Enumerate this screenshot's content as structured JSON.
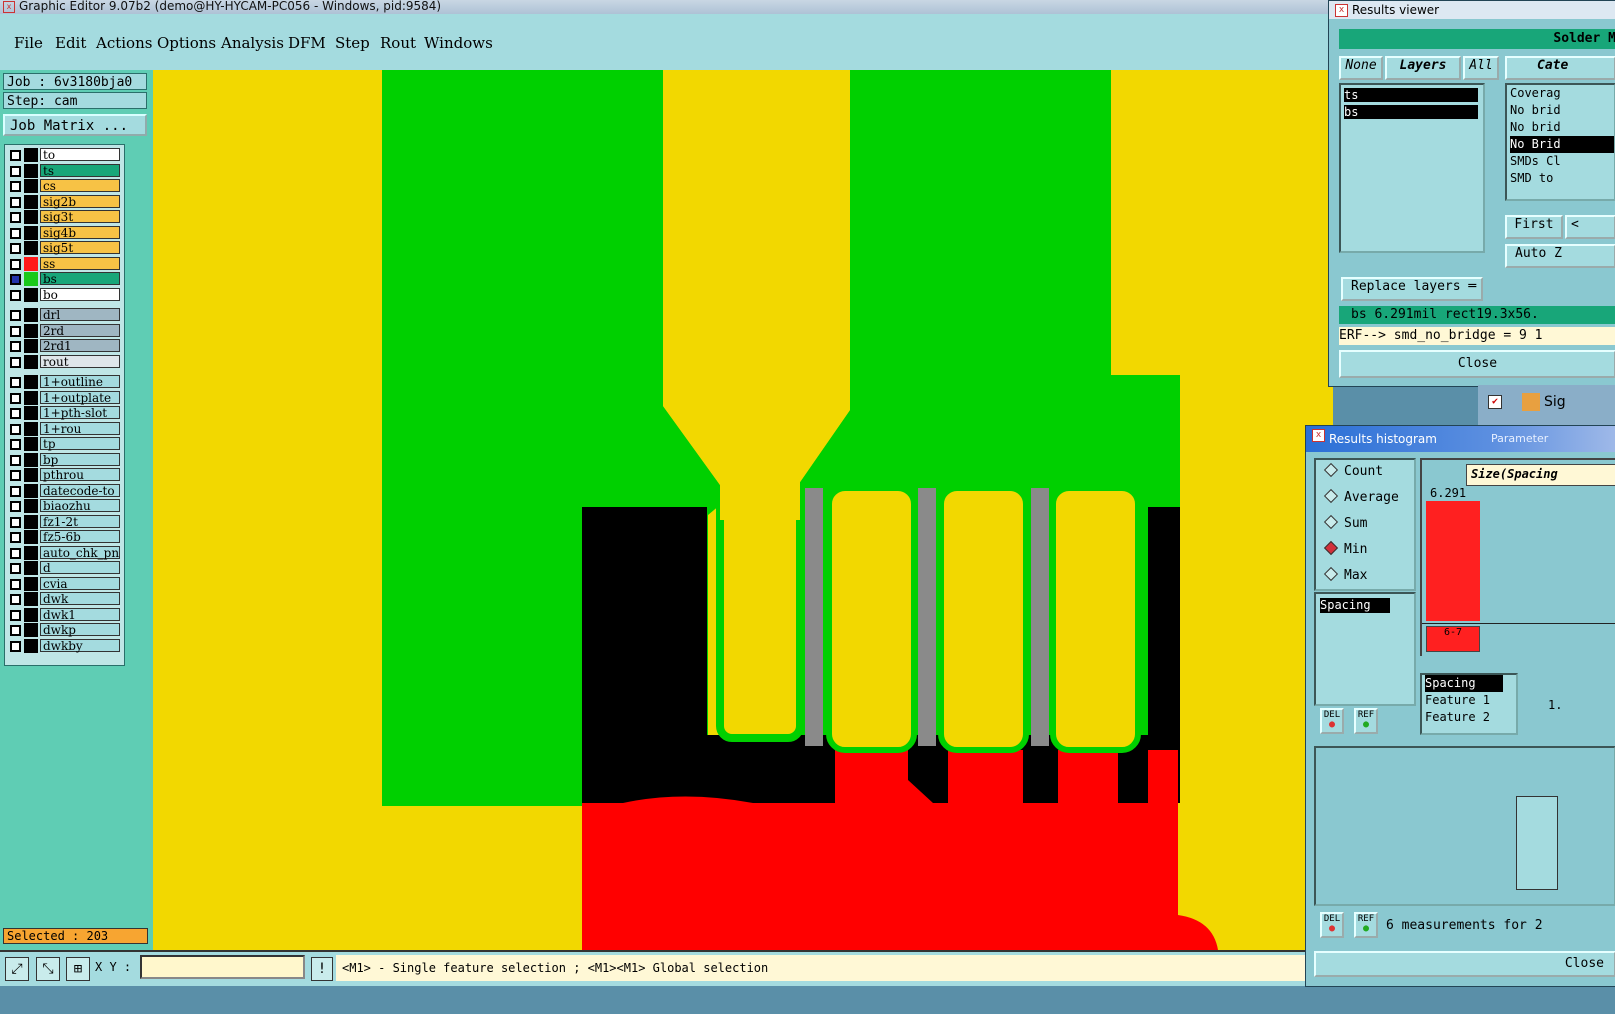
{
  "window_title": "Graphic Editor 9.07b2 (demo@HY-HYCAM-PC056 - Windows, pid:9584)",
  "menu": [
    "File",
    "Edit",
    "Actions",
    "Options",
    "Analysis",
    "DFM",
    "Step",
    "Rout",
    "Windows"
  ],
  "job": {
    "job_label": "Job : 6v3180bja0",
    "step_label": "Step: cam",
    "matrix_button": "Job Matrix ..."
  },
  "layers": [
    {
      "name": "to",
      "bg": "#ffffff",
      "sw": "#000000"
    },
    {
      "name": "ts",
      "bg": "#18a679",
      "sw": "#000000",
      "active": true
    },
    {
      "name": "cs",
      "bg": "#f7c245",
      "sw": "#000000"
    },
    {
      "name": "sig2b",
      "bg": "#f7c245",
      "sw": "#000000"
    },
    {
      "name": "sig3t",
      "bg": "#f7c245",
      "sw": "#000000"
    },
    {
      "name": "sig4b",
      "bg": "#f7c245",
      "sw": "#000000"
    },
    {
      "name": "sig5t",
      "bg": "#f7c245",
      "sw": "#000000"
    },
    {
      "name": "ss",
      "bg": "#f7c245",
      "sw": "#ff1a1a"
    },
    {
      "name": "bs",
      "bg": "#18a679",
      "sw": "#1ac91a",
      "work": true
    },
    {
      "name": "bo",
      "bg": "#ffffff",
      "sw": "#000000"
    },
    {
      "name": "drl",
      "bg": "#9fb6c2",
      "sw": "#000000"
    },
    {
      "name": "2rd",
      "bg": "#9fb6c2",
      "sw": "#000000"
    },
    {
      "name": "2rd1",
      "bg": "#9fb6c2",
      "sw": "#000000"
    },
    {
      "name": "rout",
      "bg": "#dfe6ea",
      "sw": "#000000"
    },
    {
      "name": "1+outline",
      "bg": "#a4dbdf",
      "sw": "#000000"
    },
    {
      "name": "1+outplate",
      "bg": "#a4dbdf",
      "sw": "#000000"
    },
    {
      "name": "1+pth-slot",
      "bg": "#a4dbdf",
      "sw": "#000000"
    },
    {
      "name": "1+rou",
      "bg": "#a4dbdf",
      "sw": "#000000"
    },
    {
      "name": "tp",
      "bg": "#a4dbdf",
      "sw": "#000000"
    },
    {
      "name": "bp",
      "bg": "#a4dbdf",
      "sw": "#000000"
    },
    {
      "name": "pthrou",
      "bg": "#a4dbdf",
      "sw": "#000000"
    },
    {
      "name": "datecode-to",
      "bg": "#a4dbdf",
      "sw": "#000000"
    },
    {
      "name": "biaozhu",
      "bg": "#a4dbdf",
      "sw": "#000000"
    },
    {
      "name": "fz1-2t",
      "bg": "#a4dbdf",
      "sw": "#000000"
    },
    {
      "name": "fz5-6b",
      "bg": "#a4dbdf",
      "sw": "#000000"
    },
    {
      "name": "auto_chk_pn",
      "bg": "#a4dbdf",
      "sw": "#000000"
    },
    {
      "name": "d",
      "bg": "#a4dbdf",
      "sw": "#000000"
    },
    {
      "name": "cvia",
      "bg": "#a4dbdf",
      "sw": "#000000"
    },
    {
      "name": "dwk",
      "bg": "#a4dbdf",
      "sw": "#000000"
    },
    {
      "name": "dwk1",
      "bg": "#a4dbdf",
      "sw": "#000000"
    },
    {
      "name": "dwkp",
      "bg": "#a4dbdf",
      "sw": "#000000"
    },
    {
      "name": "dwkby",
      "bg": "#a4dbdf",
      "sw": "#000000"
    }
  ],
  "selected": "Selected : 203",
  "bottom": {
    "xy_label": "X Y :",
    "xy_value": "",
    "hint": "<M1> - Single feature selection ; <M1><M1> Global selection"
  },
  "results_viewer": {
    "title": "Results viewer",
    "header": "Solder M",
    "btn_none": "None",
    "btn_layers": "Layers",
    "btn_all": "All",
    "btn_cat": "Cate",
    "layer_list": [
      "ts",
      "bs"
    ],
    "categories": [
      "Coverag",
      "No brid",
      "No brid",
      "No Brid",
      "SMDs Cl",
      "SMD to"
    ],
    "btn_first": "First",
    "btn_prev": "<",
    "btn_auto": "Auto Z",
    "replace": "Replace layers",
    "status1": "bs 6.291mil  rect19.3x56.",
    "status2": "ERF--> smd_no_bridge = 9 1",
    "close": "Close",
    "sig_label": "Sig"
  },
  "results_histogram": {
    "title": "Results histogram",
    "side_tab": "Parameter",
    "modes": [
      {
        "label": "Count",
        "on": false
      },
      {
        "label": "Average",
        "on": false
      },
      {
        "label": "Sum",
        "on": false
      },
      {
        "label": "Min",
        "on": true
      },
      {
        "label": "Max",
        "on": false
      }
    ],
    "list_item": "Spacing",
    "del": "DEL",
    "ref": "REF",
    "axis_title": "Size(Spacing",
    "bar_value": "6.291",
    "bar_label": "6-7",
    "detail_rows": [
      "Spacing",
      "Feature 1",
      "Feature 2"
    ],
    "detail_num": "1.",
    "measurements": "6 measurements for 2",
    "close": "Close"
  }
}
